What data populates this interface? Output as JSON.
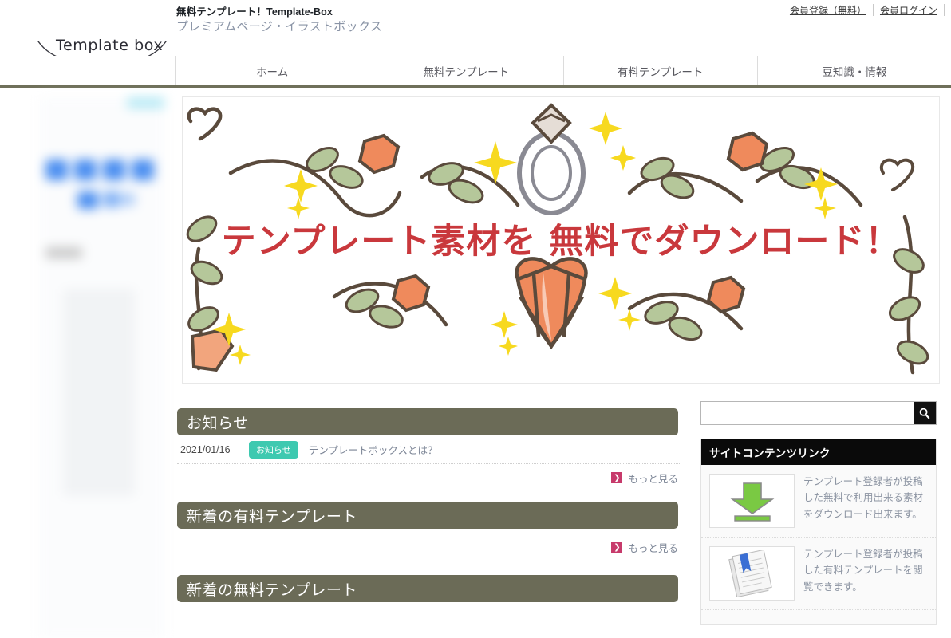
{
  "header": {
    "site_title": "無料テンプレート！Template-Box",
    "site_subtitle": "プレミアムページ・イラストボックス",
    "logo_text": "Template box",
    "member_register": "会員登録（無料）",
    "member_login": "会員ログイン"
  },
  "nav": {
    "items": [
      {
        "label": "ホーム"
      },
      {
        "label": "無料テンプレート"
      },
      {
        "label": "有料テンプレート"
      },
      {
        "label": "豆知識・情報"
      }
    ]
  },
  "banner": {
    "text": "テンプレート素材を 無料でダウンロード！",
    "text_color": "#c9383c"
  },
  "sections": {
    "news": {
      "heading": "お知らせ",
      "rows": [
        {
          "date": "2021/01/16",
          "badge": "お知らせ",
          "title": "テンプレートボックスとは？"
        }
      ],
      "more_label": "もっと見る"
    },
    "paid_new": {
      "heading": "新着の有料テンプレート",
      "more_label": "もっと見る"
    },
    "free_new": {
      "heading": "新着の無料テンプレート"
    }
  },
  "sidebar": {
    "search_placeholder": "",
    "search_value": "",
    "panel_heading": "サイトコンテンツリンク",
    "items": [
      {
        "icon": "download-arrow-icon",
        "text": "テンプレート登録者が投稿した無料で利用出来る素材をダウンロード出来ます。"
      },
      {
        "icon": "documents-icon",
        "text": "テンプレート登録者が投稿した有料テンプレートを閲覧できます。"
      }
    ]
  },
  "colors": {
    "section_head": "#6b6b57",
    "badge_teal": "#3ec9b0",
    "more_arrow": "#c73a6b",
    "nav_border": "#6f705a",
    "panel_head": "#0a0a0a"
  }
}
